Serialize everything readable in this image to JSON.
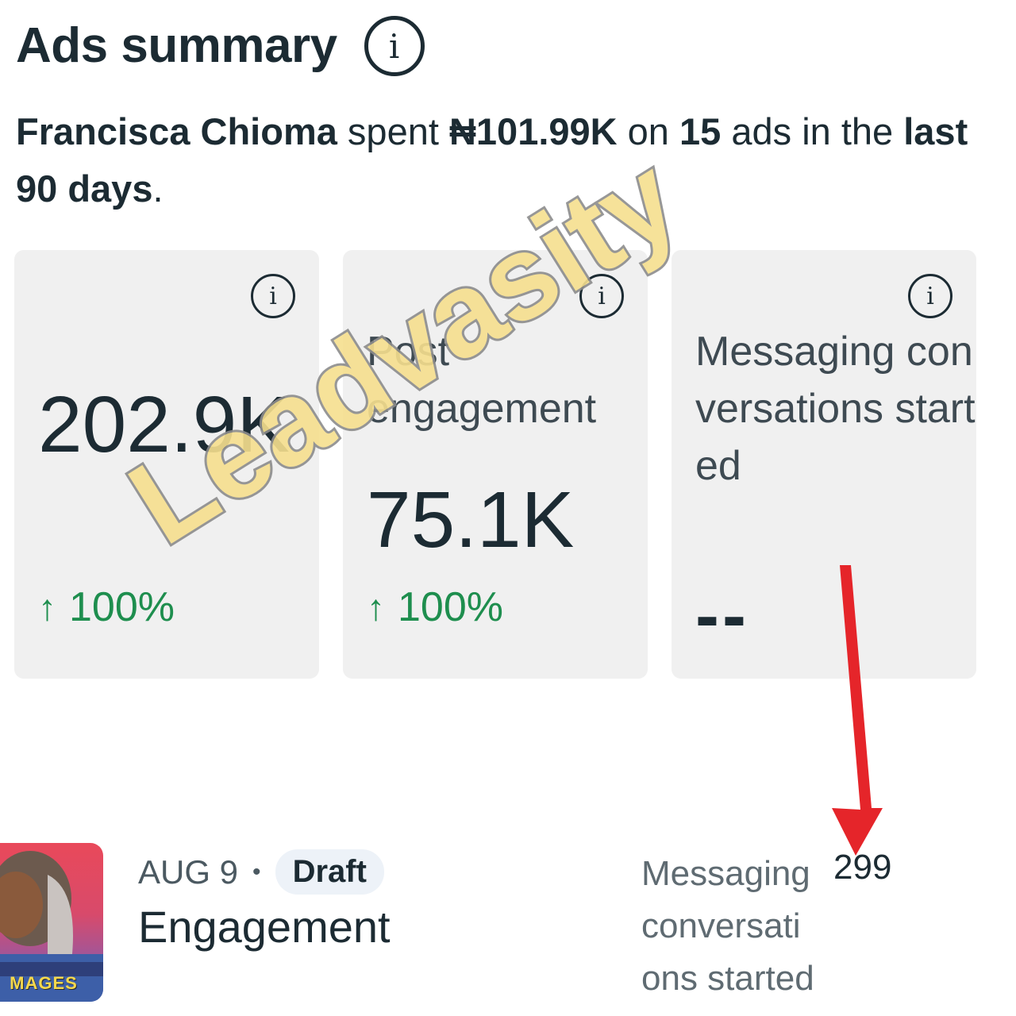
{
  "header": {
    "title": "Ads summary",
    "info_icon": "info-icon"
  },
  "summary": {
    "name": "Francisca Chioma",
    "spent_text": " spent ",
    "amount": "₦101.99K",
    "on_text": " on ",
    "ad_count": "15",
    "ads_in_text": " ads in the ",
    "period": "last 90 days",
    "end": "."
  },
  "cards": [
    {
      "label": "",
      "value": "202.9K",
      "delta": "100%",
      "delta_icon": "arrow-up-icon"
    },
    {
      "label": "Post engagement",
      "value": "75.1K",
      "delta": "100%",
      "delta_icon": "arrow-up-icon"
    },
    {
      "label": "Messaging conversations started",
      "value": "--",
      "delta": ""
    }
  ],
  "ad": {
    "thumbnail_text": "MAGES",
    "date": "AUG 9",
    "separator": "•",
    "status": "Draft",
    "name": "Engagement",
    "metric_label": "Messaging conversations started",
    "metric_value": "299"
  },
  "watermark": "Leadvasity",
  "colors": {
    "accent_green": "#1e8e4e",
    "arrow_red": "#e5252a",
    "card_bg": "#f0f0f0",
    "text": "#1c2b33"
  }
}
